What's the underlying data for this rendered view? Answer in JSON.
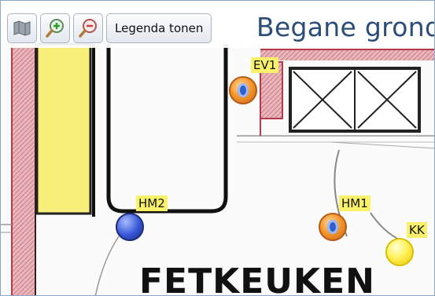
{
  "toolbar": {
    "buttons": [
      {
        "name": "map-layers",
        "icon": "map-icon"
      },
      {
        "name": "zoom-in",
        "icon": "zoom-in-icon"
      },
      {
        "name": "zoom-out",
        "icon": "zoom-out-icon"
      }
    ],
    "legend_label": "Legenda tonen"
  },
  "floor": {
    "title": "Begane grond"
  },
  "room": {
    "name": "FETKEUKEN"
  },
  "sensors": [
    {
      "id": "EV1",
      "label": "EV1",
      "color": "orange"
    },
    {
      "id": "HM2",
      "label": "HM2",
      "color": "blue"
    },
    {
      "id": "HM1",
      "label": "HM1",
      "color": "orange"
    },
    {
      "id": "KK",
      "label": "KK",
      "color": "yellow"
    }
  ],
  "colors": {
    "title": "#2b4d78",
    "label_bg": "#f9f16a",
    "wall_red": "#b53a4b",
    "wall_fill": "#e9b9bd",
    "yellow_block": "#f7ef7a"
  }
}
